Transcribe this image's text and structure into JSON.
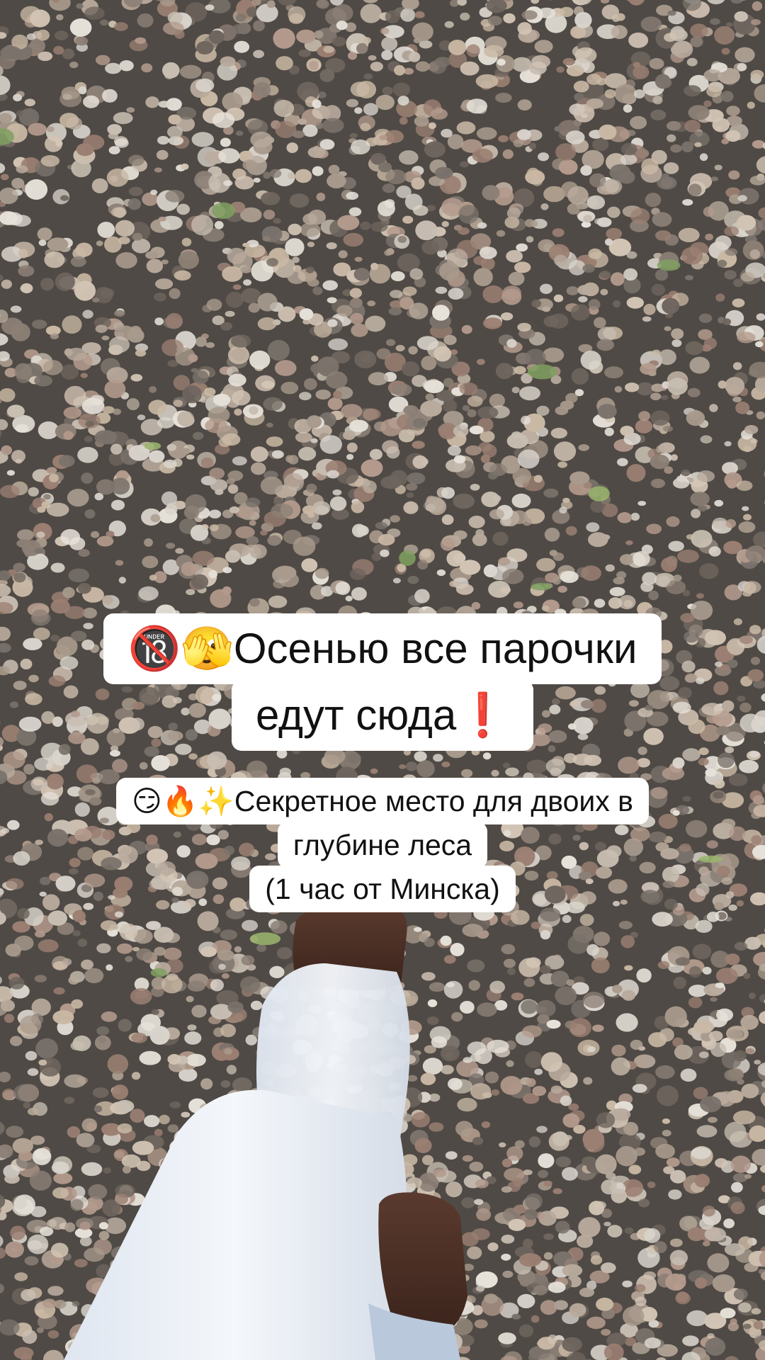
{
  "overlay": {
    "headline": {
      "line1": "🔞🫣Осенью все парочки",
      "line2": "едут сюда❗"
    },
    "subtitle": {
      "line1": "😏🔥✨Секретное место для двоих в",
      "line2": "глубине леса",
      "line3": "(1 час от Минска)"
    }
  },
  "scene": {
    "ground": "gravel-pebbles",
    "subject": "walking-legs-white-trousers-brown-shoes",
    "colors": {
      "ground_base": "#5c5751",
      "trousers": "#e9eef6",
      "shoes": "#4a2c22",
      "caption_bg": "#ffffff",
      "caption_text": "#111111"
    }
  }
}
